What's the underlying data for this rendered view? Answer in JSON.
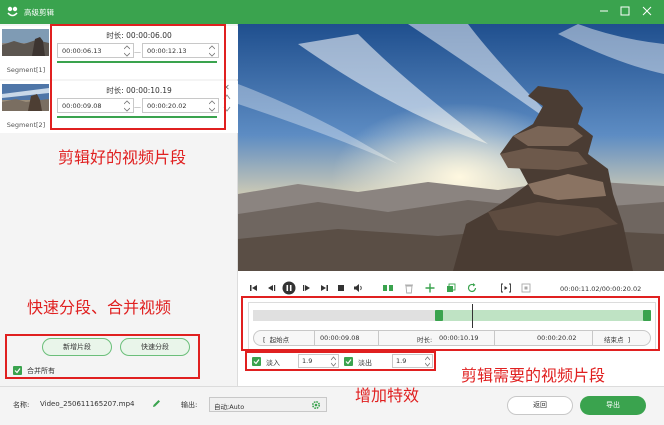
{
  "window": {
    "title": "高级剪辑",
    "icon": "frog-logo-icon",
    "controls": [
      "minimize-icon",
      "maximize-icon",
      "close-icon"
    ]
  },
  "segments": [
    {
      "label": "Segment[1]",
      "duration": "时长: 00:00:06.00",
      "start": "00:00:06.13",
      "end": "00:00:12.13"
    },
    {
      "label": "Segment[2]",
      "duration": "时长: 00:00:10.19",
      "start": "00:00:09.08",
      "end": "00:00:20.02"
    }
  ],
  "left_actions": {
    "add_segment": "新增片段",
    "quick_split": "快速分段",
    "merge_all": "合并所有",
    "merge_all_checked": true
  },
  "player": {
    "timecode": "00:00:11.02/00:00:20.02"
  },
  "trim": {
    "start_label": "起始点",
    "start_value": "00:00:09.08",
    "duration_label": "时长:",
    "duration_value": "00:00:10.19",
    "end_value": "00:00:20.02",
    "end_label": "结束点",
    "selection_start_fraction": 0.4535,
    "playhead_fraction": 0.55
  },
  "effects": {
    "fade_in_label": "淡入",
    "fade_in_value": "1.9",
    "fade_in_checked": true,
    "fade_out_label": "淡出",
    "fade_out_value": "1.9",
    "fade_out_checked": true
  },
  "bottom": {
    "name_label": "名称:",
    "file_name": "Video_250611165207.mp4",
    "output_label": "输出:",
    "output_value": "自动;Auto",
    "back_button": "返回",
    "export_button": "导出"
  },
  "annotations": {
    "segments_note": "剪辑好的视频片段",
    "split_merge_note": "快速分段、合并视频",
    "clip_note": "剪辑需要的视频片段",
    "effects_note": "增加特效"
  },
  "colors": {
    "accent": "#3aa34e",
    "annotation": "#e02020"
  }
}
